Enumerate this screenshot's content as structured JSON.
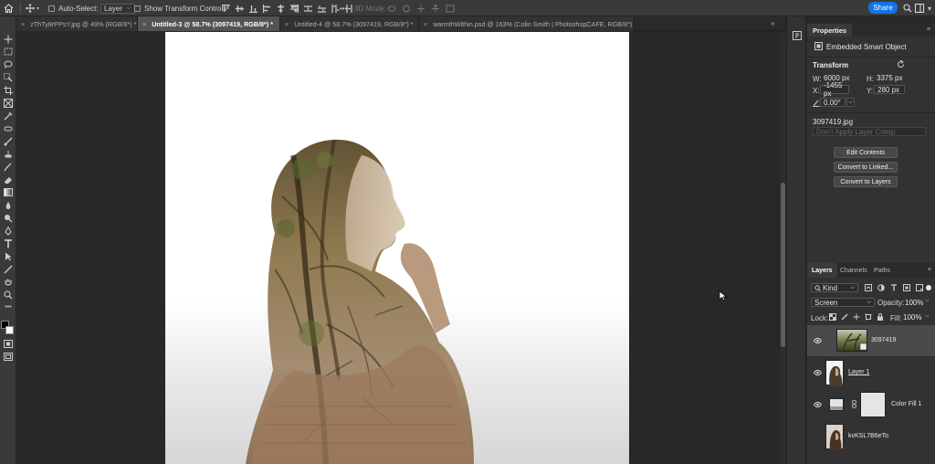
{
  "options_bar": {
    "auto_select_label": "Auto-Select:",
    "layer_dropdown": "Layer",
    "show_transform_label": "Show Transform Controls",
    "mode_3d_label": "3D Mode:",
    "share_label": "Share",
    "more_label": "•••"
  },
  "tabs": [
    {
      "label": "zThTy8rPPsY.jpg @ 49% (RGB/8*) *",
      "active": false
    },
    {
      "label": "Untitled-3 @ 58.7% (3097419, RGB/8*) *",
      "active": true
    },
    {
      "label": "Untitled-4 @ 58.7% (3097419, RGB/8*) *",
      "active": false
    },
    {
      "label": "warmthWithin.psd @ 163% (Colin Smith | PhotoshopCAFE, RGB/8*)",
      "active": false
    }
  ],
  "properties": {
    "title": "Properties",
    "object_type": "Embedded Smart Object",
    "transform_heading": "Transform",
    "w_label": "W:",
    "w_value": "6000 px",
    "h_label": "H:",
    "h_value": "3375 px",
    "x_label": "X:",
    "x_value": "-1455 px",
    "y_label": "Y:",
    "y_value": "280 px",
    "angle_value": "0.00°",
    "filename": "3097419.jpg",
    "layer_comp": "Don't Apply Layer Comp",
    "btn_edit": "Edit Contents",
    "btn_linked": "Convert to Linked...",
    "btn_layers": "Convert to Layers"
  },
  "layers_panel": {
    "tabs": [
      "Layers",
      "Channels",
      "Paths"
    ],
    "kind_label": "Kind",
    "blend_mode": "Screen",
    "opacity_label": "Opacity:",
    "opacity_value": "100%",
    "lock_label": "Lock:",
    "fill_label": "Fill:",
    "fill_value": "100%",
    "layers": [
      {
        "name": "3097419",
        "selected": true
      },
      {
        "name": "Layer 1",
        "selected": false
      },
      {
        "name": "Color Fill 1",
        "selected": false
      },
      {
        "name": "kvKSL7B6eTo",
        "selected": false
      }
    ]
  },
  "colors": {
    "accent": "#1473e6",
    "panel": "#323232",
    "workspace": "#282828"
  }
}
